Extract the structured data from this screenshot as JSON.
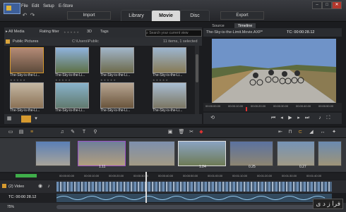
{
  "menu": [
    "File",
    "Edit",
    "Setup",
    "E-Store"
  ],
  "toolbar": {
    "import": "Import",
    "export": "Export"
  },
  "tabs": [
    {
      "label": "Library"
    },
    {
      "label": "Movie"
    },
    {
      "label": "Disc"
    }
  ],
  "library": {
    "all_media": "All Media",
    "rating_filter": "Rating filter",
    "mode_3d": "3D",
    "tags": "Tags",
    "search_placeholder": "Search your current view",
    "folder": "Public Pictures",
    "folder_path": "C:\\Users\\Public",
    "status": "11 items, 1 selected",
    "items": [
      {
        "caption": "The-Sky-is-the-Li..."
      },
      {
        "caption": "The-Sky-is-the-Li..."
      },
      {
        "caption": "The-Sky-is-the-Li..."
      },
      {
        "caption": "The-Sky-is-the-Li..."
      },
      {
        "caption": "The-Sky-is-the-Li..."
      },
      {
        "caption": "The-Sky-is-the-Li..."
      },
      {
        "caption": "The-Sky-is-the-Li..."
      },
      {
        "caption": "The-Sky-is-the-Li..."
      }
    ]
  },
  "player": {
    "filename": "The-Sky-is-the-Limit.Movie.AXP*",
    "timecode": "TC: 00:00:28.12",
    "tabs": [
      "Source",
      "Timeline"
    ],
    "ruler": [
      "00:00:00.00",
      "00:00:10.00",
      "00:00:20.00",
      "00:00:30.00",
      "00:00:40.00",
      "00:00:50.00"
    ]
  },
  "storyboard": {
    "numbers": [
      "1.11",
      "1.24",
      "0.25",
      "0.27"
    ]
  },
  "timeline": {
    "track_name": "(2) Video",
    "timecode": "TC: 00:00 28.12",
    "zoom": "75%",
    "ruler": [
      "00:00:00.00",
      "00:00:10.00",
      "00:00:20.00",
      "00:00:30.00",
      "00:00:40.00",
      "00:00:50.00",
      "00:01:00.00",
      "00:01:10.00",
      "00:01:20.00",
      "00:01:30.00",
      "00:01:40.00"
    ]
  },
  "watermark": "فرا ز د ی"
}
